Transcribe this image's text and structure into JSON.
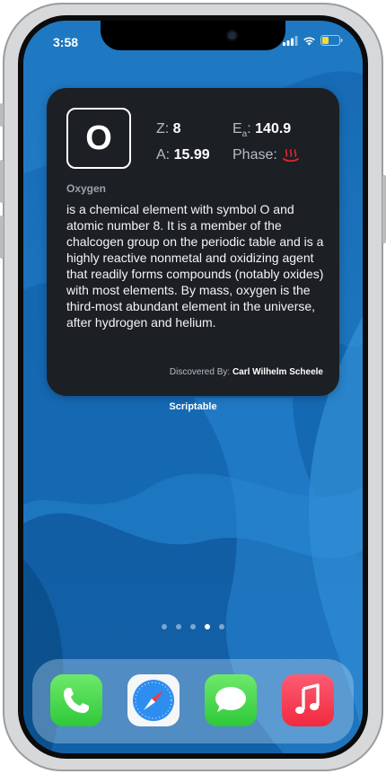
{
  "status_bar": {
    "time": "3:58"
  },
  "widget": {
    "symbol": "O",
    "z_label": "Z:",
    "z_value": "8",
    "ea_label_main": "E",
    "ea_label_sub": "a",
    "ea_label_colon": ":",
    "ea_value": "140.9",
    "a_label": "A:",
    "a_value": "15.99",
    "phase_label": "Phase:",
    "name": "Oxygen",
    "description": "is a chemical element with symbol O and atomic number 8. It is a member of the chalcogen group on the periodic table and is a highly reactive nonmetal and oxidizing agent that readily forms compounds (notably oxides) with most elements. By mass, oxygen is the third-most abundant element in the universe, after hydrogen and helium.",
    "discovered_label": "Discovered By:",
    "discovered_value": "Carl Wilhelm Scheele"
  },
  "widget_caption": "Scriptable",
  "page_dots": {
    "count": 5,
    "active_index": 3
  },
  "dock": {
    "apps": [
      "phone-icon",
      "safari-icon",
      "messages-icon",
      "music-icon"
    ]
  },
  "colors": {
    "widget_bg": "#1c1f24",
    "phase_icon": "#e0262f"
  }
}
